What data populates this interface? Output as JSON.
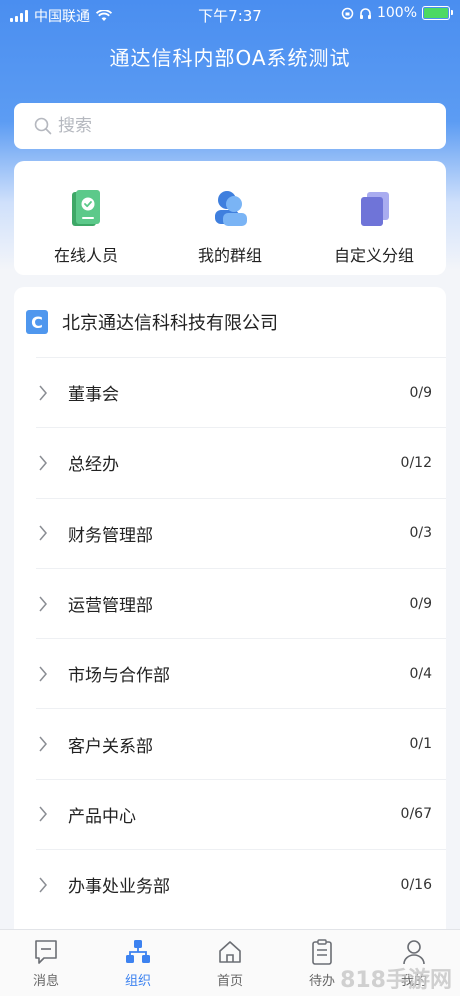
{
  "status_bar": {
    "carrier": "中国联通",
    "time": "下午7:37",
    "battery": "100%"
  },
  "header": {
    "title": "通达信科内部OA系统测试"
  },
  "search": {
    "placeholder": "搜索"
  },
  "quick_actions": [
    {
      "label": "在线人员",
      "icon": "online-phone-icon"
    },
    {
      "label": "我的群组",
      "icon": "group-icon"
    },
    {
      "label": "自定义分组",
      "icon": "custom-group-icon"
    }
  ],
  "org": {
    "badge": "C",
    "name": "北京通达信科科技有限公司",
    "departments": [
      {
        "name": "董事会",
        "count": "0/9"
      },
      {
        "name": "总经办",
        "count": "0/12"
      },
      {
        "name": "财务管理部",
        "count": "0/3"
      },
      {
        "name": "运营管理部",
        "count": "0/9"
      },
      {
        "name": "市场与合作部",
        "count": "0/4"
      },
      {
        "name": "客户关系部",
        "count": "0/1"
      },
      {
        "name": "产品中心",
        "count": "0/67"
      },
      {
        "name": "办事处业务部",
        "count": "0/16"
      }
    ]
  },
  "tabs": [
    {
      "label": "消息",
      "icon": "message-icon"
    },
    {
      "label": "组织",
      "icon": "org-icon"
    },
    {
      "label": "首页",
      "icon": "home-icon"
    },
    {
      "label": "待办",
      "icon": "todo-icon"
    },
    {
      "label": "我的",
      "icon": "profile-icon"
    }
  ],
  "active_tab": "组织",
  "watermark": "818手游网",
  "colors": {
    "accent": "#3c82f0",
    "header_gradient_top": "#4a8ef0",
    "online_icon": "#4dbd74",
    "group_icon": "#4f8fe8",
    "custom_group_icon": "#7b7fe0"
  }
}
